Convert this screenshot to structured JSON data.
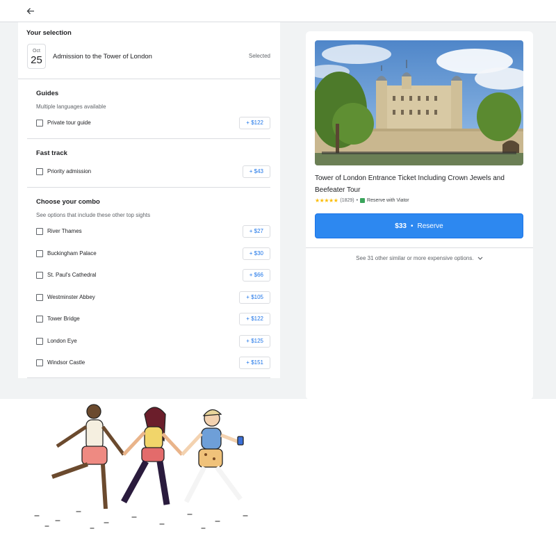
{
  "header": {
    "back_icon": "arrow-left-icon"
  },
  "selection": {
    "title": "Your selection",
    "date_month": "Oct",
    "date_day": "25",
    "name": "Admission to the Tower of London",
    "status": "Selected"
  },
  "guides": {
    "title": "Guides",
    "subtitle": "Multiple languages available",
    "options": [
      {
        "label": "Private tour guide",
        "price": "+ $122"
      }
    ]
  },
  "fast_track": {
    "title": "Fast track",
    "options": [
      {
        "label": "Priority admission",
        "price": "+ $43"
      }
    ]
  },
  "combo": {
    "title": "Choose your combo",
    "subtitle": "See options that include these other top sights",
    "options": [
      {
        "label": "River Thames",
        "price": "+ $27"
      },
      {
        "label": "Buckingham Palace",
        "price": "+ $30"
      },
      {
        "label": "St. Paul's Cathedral",
        "price": "+ $66"
      },
      {
        "label": "Westminster Abbey",
        "price": "+ $105"
      },
      {
        "label": "Tower Bridge",
        "price": "+ $122"
      },
      {
        "label": "London Eye",
        "price": "+ $125"
      },
      {
        "label": "Windsor Castle",
        "price": "+ $151"
      }
    ]
  },
  "product": {
    "title": "Tower of London Entrance Ticket Including Crown Jewels and Beefeater Tour",
    "rating": 4.5,
    "stars": "★★★★★",
    "reviews": "(1829)",
    "separator": "•",
    "provider": "Reserve with Viator",
    "reserve_price": "$33",
    "reserve_dot": "•",
    "reserve_label": "Reserve",
    "more_options": "See 31 other similar or more expensive options."
  },
  "colors": {
    "accent": "#1a73e8",
    "reserve_bg": "#2d88f0",
    "star": "#fbbc04"
  }
}
